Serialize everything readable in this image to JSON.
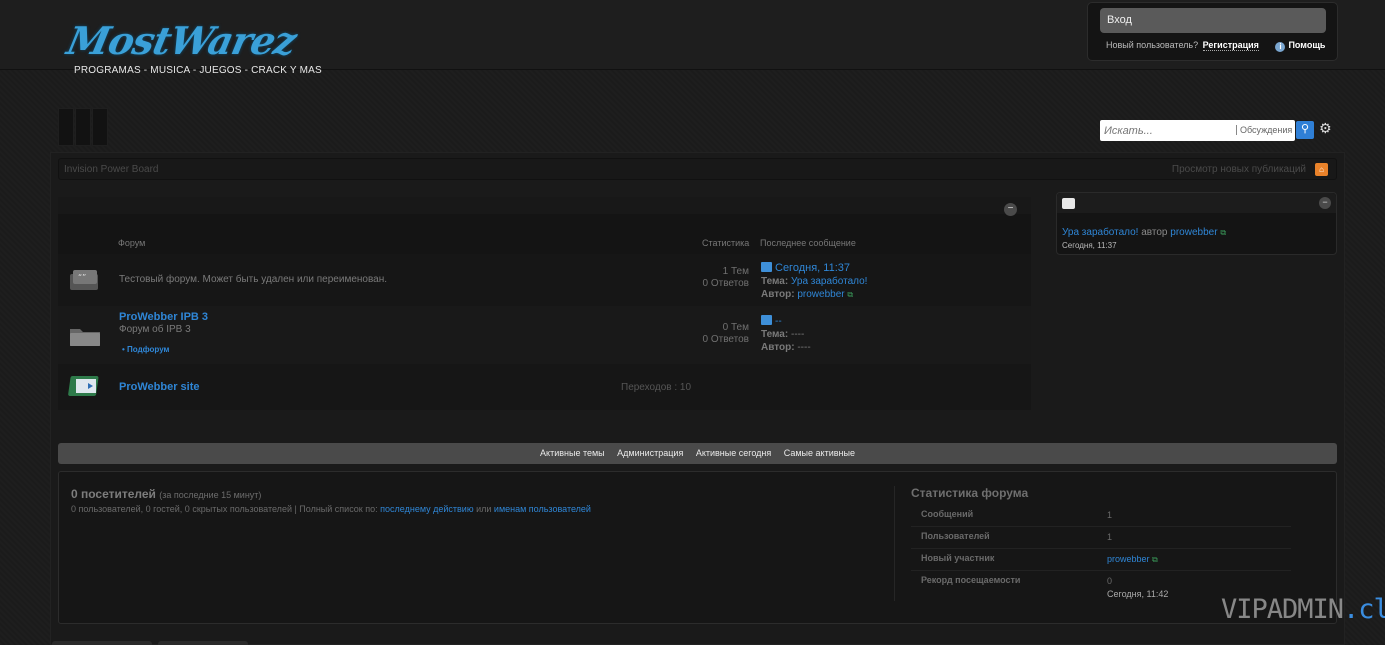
{
  "header": {
    "logo_text": "MostWarez",
    "tagline": "PROGRAMAS - MUSICA - JUEGOS - CRACK Y MAS",
    "login_label": "Вход",
    "new_user_text": "Новый пользователь?",
    "register_label": "Регистрация",
    "help_label": "Помощь"
  },
  "search": {
    "placeholder": "Искать...",
    "scope": "Обсуждения",
    "button_icon": "search-icon",
    "settings_icon": "gear-icon"
  },
  "breadcrumb": {
    "board_name": "Invision Power Board",
    "new_posts_label": "Просмотр новых публикаций"
  },
  "forum_table": {
    "headers": {
      "forum": "Форум",
      "stats": "Статистика",
      "last_post": "Последнее сообщение"
    },
    "rows": [
      {
        "title": "",
        "description": "Тестовый форум. Может быть удален или переименован.",
        "topics": "1 Тем",
        "replies": "0 Ответов",
        "last_date": "Сегодня, 11:37",
        "topic_label": "Тема:",
        "topic": "Ура заработало!",
        "author_label": "Автор:",
        "author": "prowebber"
      },
      {
        "title": "ProWebber IPB 3",
        "description": "Форум об IPB 3",
        "subforum": "Подфорум",
        "topics": "0 Тем",
        "replies": "0 Ответов",
        "last_date": "--",
        "topic_label": "Тема:",
        "topic": "----",
        "author_label": "Автор:",
        "author": "----"
      },
      {
        "title": "ProWebber site",
        "redirects": "Переходов : 10"
      }
    ]
  },
  "sidebar": {
    "entry_topic": "Ура заработало!",
    "entry_by": "автор",
    "entry_author": "prowebber",
    "entry_date": "Сегодня, 11:37"
  },
  "bottom_nav": {
    "items": [
      "Активные темы",
      "Администрация",
      "Активные сегодня",
      "Самые активные"
    ]
  },
  "online": {
    "title": "0 посетителей",
    "period": "(за последние 15 минут)",
    "details": "0 пользователей, 0 гостей, 0 скрытых пользователей | Полный список по:",
    "link_last_action": "последнему действию",
    "or": "или",
    "link_names": "именам пользователей"
  },
  "board_stats": {
    "title": "Статистика форума",
    "rows": [
      {
        "label": "Сообщений",
        "value": "1"
      },
      {
        "label": "Пользователей",
        "value": "1"
      },
      {
        "label": "Новый участник",
        "value": "prowebber"
      },
      {
        "label": "Рекорд посещаемости",
        "value": "0",
        "value2": "Сегодня, 11:42"
      }
    ]
  },
  "watermark": {
    "main": "VIPADMIN",
    "suffix": ".club"
  },
  "colors": {
    "link": "#2f86d6",
    "background": "#1b1b1b",
    "nav_bar": "#4a4a4a"
  }
}
